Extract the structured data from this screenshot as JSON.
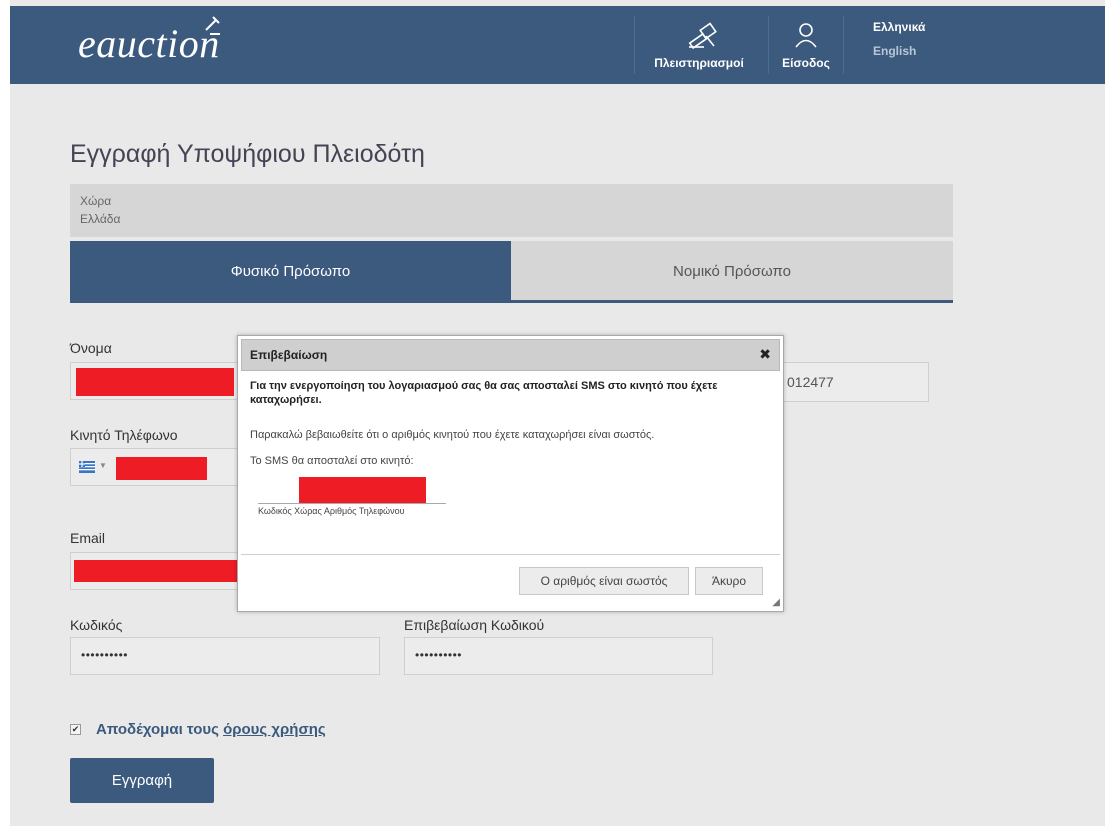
{
  "header": {
    "logo": "eauction",
    "nav": [
      {
        "label": "Πλειστηριασμοί",
        "icon": "gavel-icon"
      },
      {
        "label": "Είσοδος",
        "icon": "user-icon"
      }
    ],
    "lang_active": "Ελληνικά",
    "lang_other": "English"
  },
  "page": {
    "title": "Εγγραφή Υποψήφιου Πλειοδότη",
    "country_label": "Χώρα",
    "country_value": "Ελλάδα",
    "tabs": [
      "Φυσικό Πρόσωπο",
      "Νομικό Πρόσωπο"
    ]
  },
  "form": {
    "name_label": "Όνομα",
    "right_partial_value": "012477",
    "mobile_label": "Κινητό Τηλέφωνο",
    "email_label": "Email",
    "password_label": "Κωδικός",
    "password_value": "••••••••••",
    "confirm_label": "Επιβεβαίωση Κωδικού",
    "confirm_value": "••••••••••",
    "terms_prefix": "Αποδέχομαι τους ",
    "terms_link": "όρους χρήσης",
    "terms_checked": true,
    "register_button": "Εγγραφή"
  },
  "dialog": {
    "title": "Επιβεβαίωση",
    "close": "✖",
    "bold_text": "Για την ενεργοποίηση του λογαριασμού σας θα σας αποσταλεί SMS στο κινητό που έχετε καταχωρήσει.",
    "text1": "Παρακαλώ βεβαιωθείτε ότι ο αριθμός κινητού που έχετε καταχωρήσει είναι σωστός.",
    "text2": "Το SMS θα αποσταλεί στο κινητό:",
    "phone_caption": "Κωδικός Χώρας Αριθμός Τηλεφώνου",
    "confirm_button": "Ο αριθμός είναι σωστός",
    "cancel_button": "Άκυρο"
  },
  "colors": {
    "brand": "#3b5a7e",
    "redaction": "#ee1c24"
  }
}
